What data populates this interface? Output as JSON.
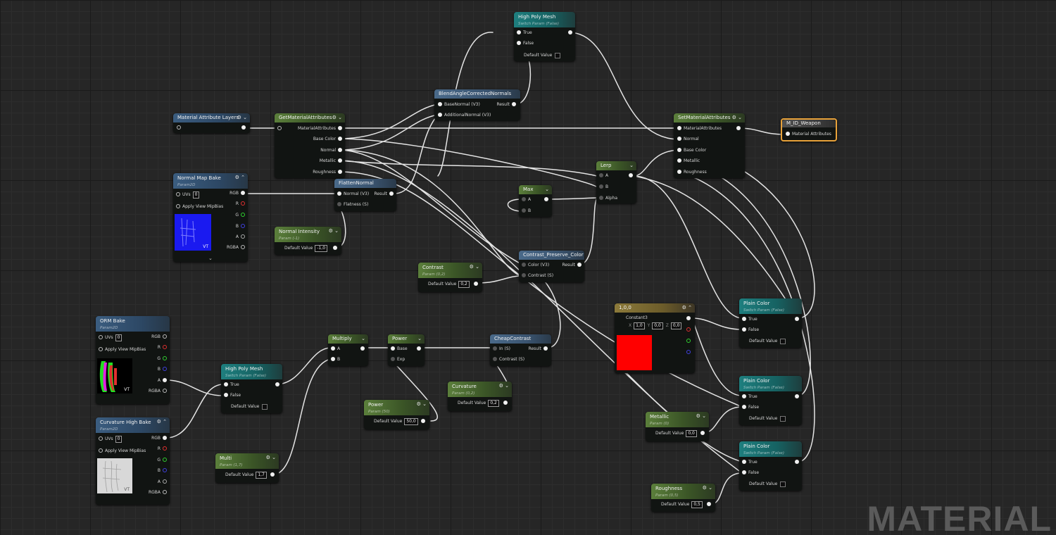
{
  "watermark": "MATERIAL",
  "nodes": {
    "high_poly_top": {
      "title": "High Poly Mesh",
      "sub": "Switch Param (False)",
      "true": "True",
      "false": "False",
      "default": "Default Value"
    },
    "blend_angle": {
      "title": "BlendAngleCorrectedNormals",
      "base_normal": "BaseNormal (V3)",
      "additional_normal": "AdditionalNormal (V3)",
      "result": "Result"
    },
    "mat_attr_layers": {
      "title": "Material Attribute Layers"
    },
    "get_attrs": {
      "title": "GetMaterialAttributes",
      "pins": [
        "MaterialAttributes",
        "Base Color",
        "Normal",
        "Metallic",
        "Roughness"
      ]
    },
    "set_attrs": {
      "title": "SetMaterialAttributes",
      "pins": [
        "MaterialAttributes",
        "Normal",
        "Base Color",
        "Metallic",
        "Roughness"
      ]
    },
    "m_id_weapon": {
      "title": "M_ID_Weapon",
      "pin": "Material Attributes"
    },
    "normal_map_bake": {
      "title": "Normal Map Bake",
      "sub": "Param2D",
      "uvs": "UVs",
      "uvs_val": "0",
      "apply_mip": "Apply View MipBias",
      "rgb": "RGB",
      "r": "R",
      "g": "G",
      "b": "B",
      "a": "A",
      "rgba": "RGBA",
      "vt": "VT"
    },
    "flatten_normal": {
      "title": "FlattenNormal",
      "normal": "Normal (V3)",
      "flatness": "Flatness (S)",
      "result": "Result"
    },
    "normal_intensity": {
      "title": "Normal Intensity",
      "sub": "Param (-1)",
      "default": "Default Value",
      "value": "-1,0"
    },
    "max": {
      "title": "Max",
      "a": "A",
      "b": "B"
    },
    "lerp": {
      "title": "Lerp",
      "a": "A",
      "b": "B",
      "alpha": "Alpha"
    },
    "contrast_preserve": {
      "title": "Contrast_Preserve_Color",
      "color": "Color (V3)",
      "contrast": "Contrast (S)",
      "result": "Result"
    },
    "contrast": {
      "title": "Contrast",
      "sub": "Param (0,2)",
      "default": "Default Value",
      "value": "0,2"
    },
    "orm_bake": {
      "title": "ORM Bake",
      "sub": "Param2D",
      "uvs": "UVs",
      "uvs_val": "0",
      "apply_mip": "Apply View MipBias",
      "rgb": "RGB",
      "r": "R",
      "g": "G",
      "b": "B",
      "a": "A",
      "rgba": "RGBA",
      "vt": "VT"
    },
    "curvature_bake": {
      "title": "Curvature High Bake",
      "sub": "Param2D",
      "uvs": "UVs",
      "uvs_val": "0",
      "apply_mip": "Apply View MipBias",
      "rgb": "RGB",
      "r": "R",
      "g": "G",
      "b": "B",
      "a": "A",
      "rgba": "RGBA",
      "vt": "VT"
    },
    "high_poly_bot": {
      "title": "High Poly Mesh",
      "sub": "Switch Param (False)",
      "true": "True",
      "false": "False",
      "default": "Default Value"
    },
    "multiply": {
      "title": "Multiply",
      "a": "A",
      "b": "B"
    },
    "power_node": {
      "title": "Power",
      "base": "Base",
      "exp": "Exp"
    },
    "cheap_contrast": {
      "title": "CheapContrast",
      "in": "In (S)",
      "contrast": "Contrast (S)",
      "result": "Result"
    },
    "curvature_param": {
      "title": "Curvature",
      "sub": "Param (0,2)",
      "default": "Default Value",
      "value": "0,2"
    },
    "power_param": {
      "title": "Power",
      "sub": "Param (50)",
      "default": "Default Value",
      "value": "50,0"
    },
    "multi_param": {
      "title": "Multi",
      "sub": "Param (1,7)",
      "default": "Default Value",
      "value": "1,7"
    },
    "const3": {
      "title": "1,0,0",
      "label": "Constant3",
      "x": "X",
      "x_val": "1,0",
      "y": "Y",
      "y_val": "0,0",
      "z": "Z",
      "z_val": "0,0",
      "swatch": "#ff0000"
    },
    "plain_color_1": {
      "title": "Plain Color",
      "sub": "Switch Param (False)",
      "true": "True",
      "false": "False",
      "default": "Default Value"
    },
    "plain_color_2": {
      "title": "Plain Color",
      "sub": "Switch Param (False)",
      "true": "True",
      "false": "False",
      "default": "Default Value"
    },
    "plain_color_3": {
      "title": "Plain Color",
      "sub": "Switch Param (False)",
      "true": "True",
      "false": "False",
      "default": "Default Value"
    },
    "metallic_param": {
      "title": "Metallic",
      "sub": "Param (0)",
      "default": "Default Value",
      "value": "0,0"
    },
    "roughness_param": {
      "title": "Roughness",
      "sub": "Param (0,5)",
      "default": "Default Value",
      "value": "0,5"
    }
  },
  "icons": {
    "collapse": "chevron-down-icon",
    "options": "gear-icon"
  },
  "colors": {
    "accent_output": "#e8a23a",
    "wire": "#e6e6e6"
  }
}
